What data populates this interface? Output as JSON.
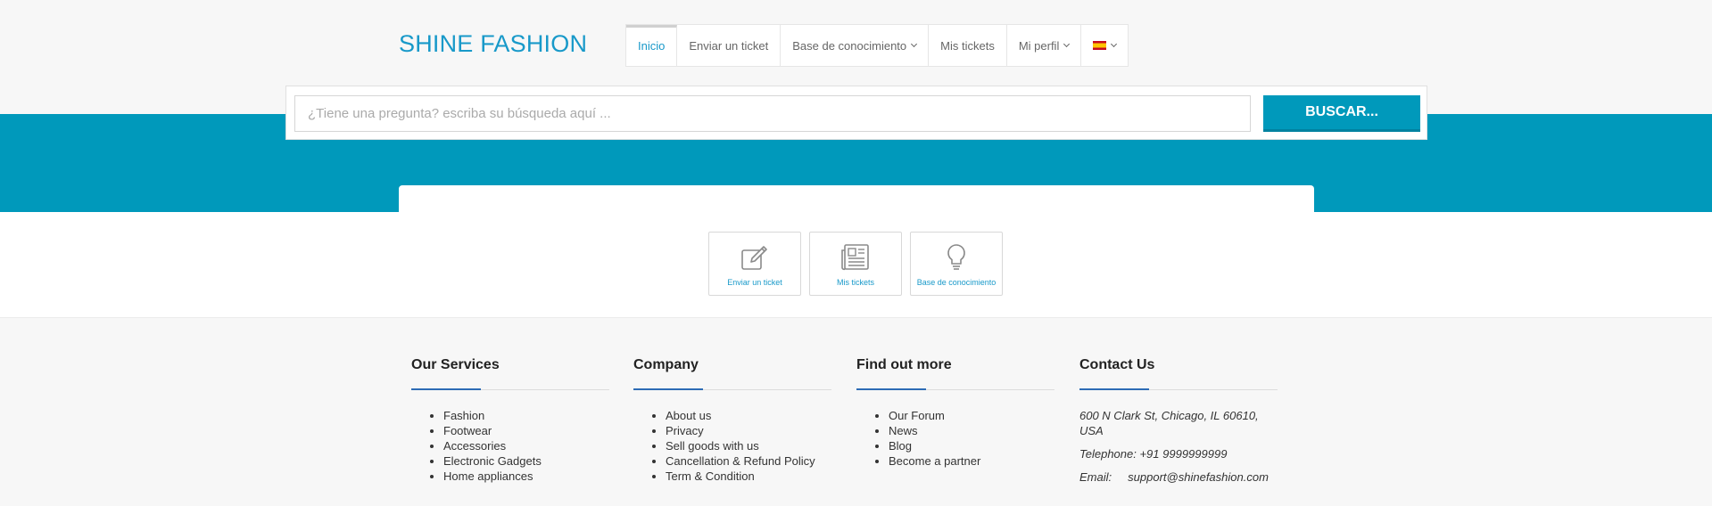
{
  "brand": {
    "logo": "SHINE FASHION"
  },
  "nav": {
    "items": [
      {
        "label": "Inicio"
      },
      {
        "label": "Enviar un ticket"
      },
      {
        "label": "Base de conocimiento"
      },
      {
        "label": "Mis tickets"
      },
      {
        "label": "Mi perfil"
      }
    ],
    "language_flag": "spain-flag-icon"
  },
  "search": {
    "placeholder": "¿Tiene una pregunta? escriba su búsqueda aquí ...",
    "button_label": "BUSCAR..."
  },
  "tiles": [
    {
      "label": "Enviar un ticket",
      "icon": "edit-icon"
    },
    {
      "label": "Mis tickets",
      "icon": "newspaper-icon"
    },
    {
      "label": "Base de conocimiento",
      "icon": "lightbulb-icon"
    }
  ],
  "footer": {
    "services": {
      "title": "Our Services",
      "items": [
        "Fashion",
        "Footwear",
        "Accessories",
        "Electronic Gadgets",
        "Home appliances"
      ]
    },
    "company": {
      "title": "Company",
      "items": [
        "About us",
        "Privacy",
        "Sell goods with us",
        "Cancellation & Refund Policy",
        "Term & Condition"
      ]
    },
    "findout": {
      "title": "Find out more",
      "items": [
        "Our Forum",
        "News",
        "Blog",
        "Become a partner"
      ]
    },
    "contact": {
      "title": "Contact Us",
      "address": "600 N Clark St, Chicago, IL 60610, USA",
      "telephone": "Telephone: +91 9999999999",
      "email": "Email:     support@shinefashion.com"
    }
  },
  "colors": {
    "accent": "#0099bb",
    "brand": "#1899c9",
    "footer_rule": "#2d6bb5"
  }
}
